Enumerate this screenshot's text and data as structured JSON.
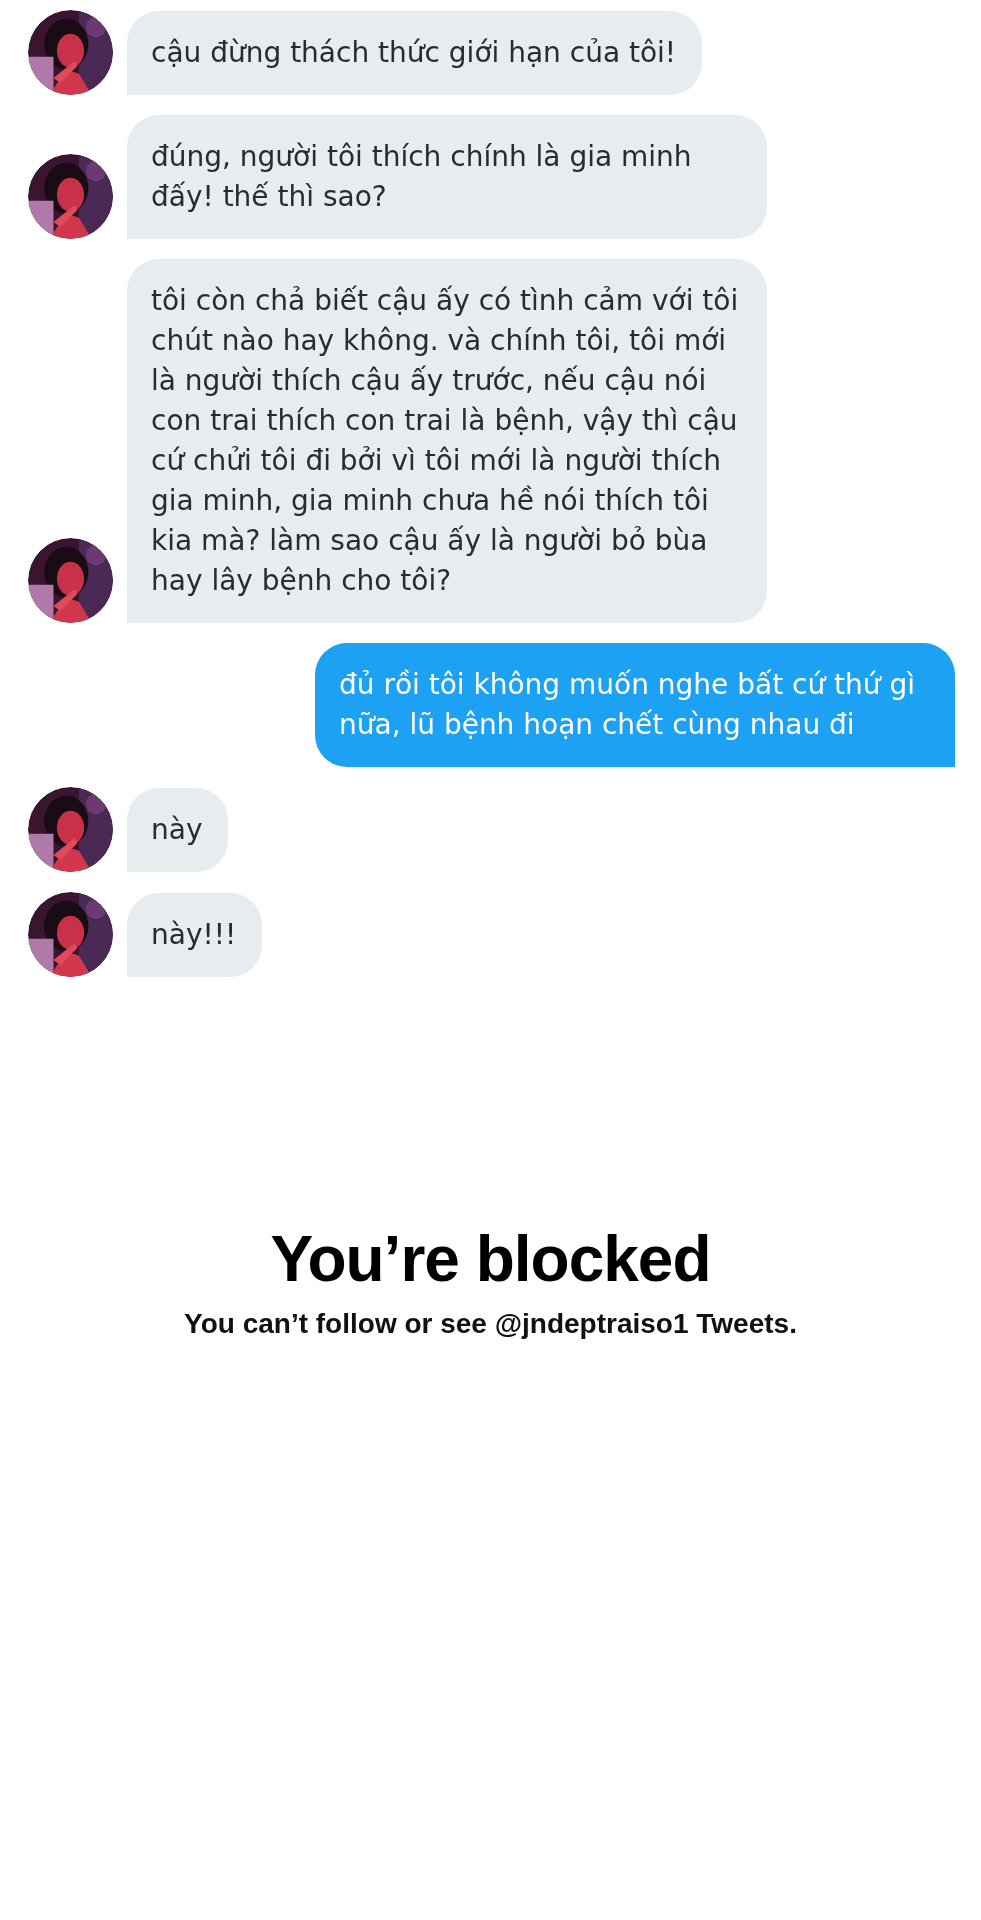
{
  "messages": [
    {
      "kind": "incoming",
      "text": "cậu đừng thách thức giới hạn của tôi!"
    },
    {
      "kind": "incoming",
      "text": "đúng, người tôi thích chính là gia minh đấy! thế thì sao?"
    },
    {
      "kind": "incoming",
      "text": "tôi còn chả biết cậu ấy có tình cảm với tôi chút nào hay không. và chính tôi, tôi mới là người thích cậu ấy trước, nếu cậu nói con trai thích con trai là bệnh, vậy thì cậu cứ chửi tôi đi bởi vì tôi mới là người thích gia minh, gia minh chưa hề nói thích tôi kia mà? làm sao cậu ấy là người bỏ bùa hay lây bệnh cho tôi?"
    },
    {
      "kind": "outgoing",
      "text": "đủ rồi tôi không muốn nghe bất cứ thứ gì nữa, lũ bệnh hoạn chết cùng nhau đi"
    },
    {
      "kind": "incoming",
      "text": "này"
    },
    {
      "kind": "incoming",
      "text": "này!!!"
    }
  ],
  "blocked": {
    "title": "You’re blocked",
    "subtitle": "You can’t follow or see @jndeptraiso1 Tweets."
  }
}
